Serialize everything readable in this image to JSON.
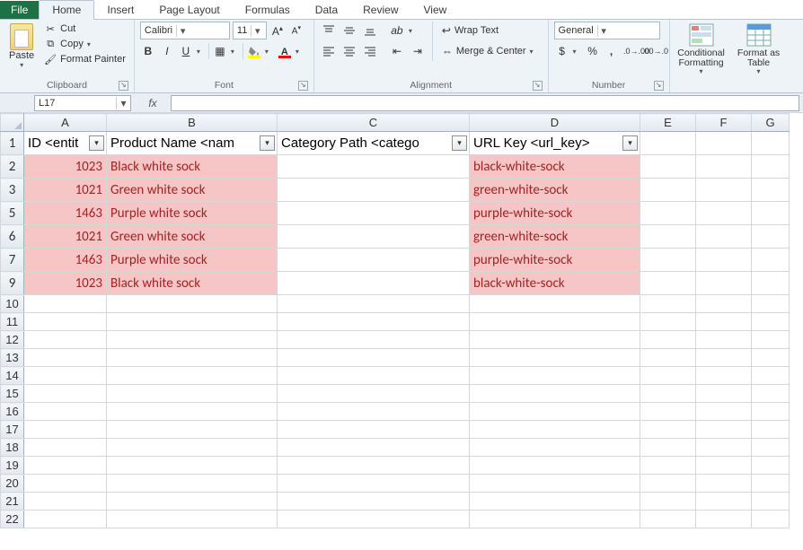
{
  "tabs": {
    "file": "File",
    "home": "Home",
    "insert": "Insert",
    "page_layout": "Page Layout",
    "formulas": "Formulas",
    "data": "Data",
    "review": "Review",
    "view": "View"
  },
  "ribbon": {
    "clipboard": {
      "label": "Clipboard",
      "paste": "Paste",
      "cut": "Cut",
      "copy": "Copy",
      "format_painter": "Format Painter"
    },
    "font": {
      "label": "Font",
      "family": "Calibri",
      "size": "11"
    },
    "alignment": {
      "label": "Alignment",
      "wrap": "Wrap Text",
      "merge": "Merge & Center"
    },
    "number": {
      "label": "Number",
      "format": "General"
    },
    "styles": {
      "conditional": "Conditional Formatting",
      "table": "Format as Table"
    }
  },
  "formula_bar": {
    "name_box": "L17",
    "fx": "fx",
    "value": ""
  },
  "grid": {
    "col_letters": [
      "A",
      "B",
      "C",
      "D",
      "E",
      "F",
      "G"
    ],
    "row_numbers": [
      1,
      2,
      3,
      5,
      6,
      7,
      9,
      10,
      11,
      12,
      13,
      14,
      15,
      16,
      17,
      18,
      19,
      20,
      21,
      22
    ],
    "headers": {
      "A": "ID <entit",
      "B": "Product Name <nam",
      "C": "Category Path <catego",
      "D": "URL Key <url_key>"
    },
    "rows": [
      {
        "n": 2,
        "id": "1023",
        "name": "Black white sock",
        "url": "black-white-sock"
      },
      {
        "n": 3,
        "id": "1021",
        "name": "Green white sock",
        "url": "green-white-sock"
      },
      {
        "n": 5,
        "id": "1463",
        "name": "Purple white sock",
        "url": "purple-white-sock"
      },
      {
        "n": 6,
        "id": "1021",
        "name": "Green white sock",
        "url": "green-white-sock"
      },
      {
        "n": 7,
        "id": "1463",
        "name": "Purple white sock",
        "url": "purple-white-sock"
      },
      {
        "n": 9,
        "id": "1023",
        "name": "Black white sock",
        "url": "black-white-sock"
      }
    ],
    "empty_rows": [
      10,
      11,
      12,
      13,
      14,
      15,
      16,
      17,
      18,
      19,
      20,
      21,
      22
    ]
  },
  "colors": {
    "pink_bg": "#f6c5c5",
    "pink_fg": "#a12424",
    "accent": "#1e7145"
  }
}
